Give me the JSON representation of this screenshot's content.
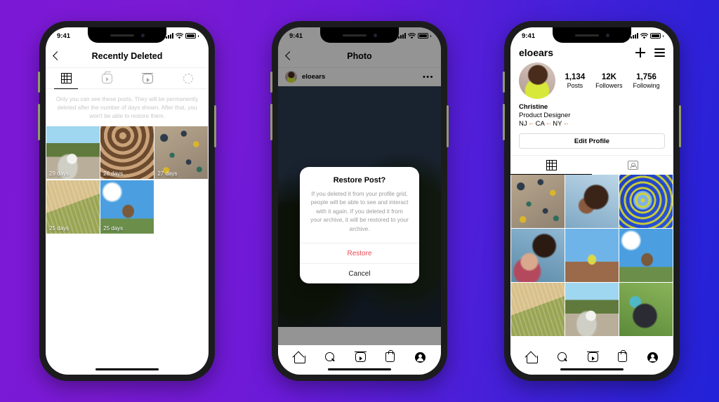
{
  "background": {
    "from": "#7b18d6",
    "to": "#2222d8"
  },
  "phones": [
    {
      "status": {
        "time": "9:41"
      },
      "header": {
        "title": "Recently Deleted",
        "back_icon": "back-chevron-icon"
      },
      "tabs": [
        {
          "name": "grid",
          "icon": "grid-icon",
          "active": true
        },
        {
          "name": "igtv",
          "icon": "igtv-icon",
          "active": false
        },
        {
          "name": "reels",
          "icon": "reels-icon",
          "active": false
        },
        {
          "name": "stories",
          "icon": "story-circle-icon",
          "active": false
        }
      ],
      "notice": "Only you can see these posts. They will be permanently deleted after the number of days shown. After that, you won't be able to restore them.",
      "grid": [
        {
          "alt": "white-dog-on-path",
          "style": "ph-dog",
          "days": "29 days"
        },
        {
          "alt": "spiral-shadow-pattern",
          "style": "ph-spiral",
          "days": "28 days"
        },
        {
          "alt": "climbing-wall-holds",
          "style": "ph-climb",
          "days": "27 days"
        },
        {
          "alt": "wheat-field",
          "style": "ph-wheat",
          "days": "25 days"
        },
        {
          "alt": "boot-against-sky",
          "style": "ph-boot",
          "days": "25 days"
        }
      ]
    },
    {
      "status": {
        "time": "9:41"
      },
      "header": {
        "title": "Photo",
        "back_icon": "back-chevron-icon"
      },
      "post": {
        "username": "eloears",
        "menu_icon": "more-options-icon",
        "photo_alt": "dark-landscape-with-grasses",
        "photo_style": "ph-landscape"
      },
      "alert": {
        "title": "Restore Post?",
        "text": "If you deleted it from your profile grid, people will be able to see and interact with it again. If you deleted it from your archive, it will be restored to your archive.",
        "confirm_label": "Restore",
        "confirm_color": "#ed4956",
        "cancel_label": "Cancel"
      }
    },
    {
      "status": {
        "time": "9:41"
      },
      "profile": {
        "handle": "eloears",
        "add_icon": "plus-icon",
        "menu_icon": "hamburger-menu-icon",
        "avatar_alt": "christine-profile-photo",
        "stats": [
          {
            "number": "1,134",
            "label": "Posts"
          },
          {
            "number": "12K",
            "label": "Followers"
          },
          {
            "number": "1,756",
            "label": "Following"
          }
        ],
        "name": "Christine",
        "role": "Product Designer",
        "locations": [
          "NJ",
          "CA",
          "NY"
        ],
        "location_arrow": "➳",
        "edit_label": "Edit Profile",
        "tabs": [
          {
            "name": "posts-grid",
            "icon": "grid-icon",
            "active": true
          },
          {
            "name": "tagged",
            "icon": "tagged-person-icon",
            "active": false
          }
        ],
        "grid": [
          {
            "alt": "climbing-wall-holds",
            "style": "ph-climb"
          },
          {
            "alt": "woman-profile-earring",
            "style": "ph-girl"
          },
          {
            "alt": "blue-yellow-spiral-art",
            "style": "ph-spiro"
          },
          {
            "alt": "two-friends-smiling",
            "style": "ph-two"
          },
          {
            "alt": "yellow-tree-city-building",
            "style": "ph-bldg"
          },
          {
            "alt": "boot-against-sky",
            "style": "ph-boot"
          },
          {
            "alt": "wheat-field",
            "style": "ph-wheat"
          },
          {
            "alt": "white-dog-on-path",
            "style": "ph-dog"
          },
          {
            "alt": "friends-feet-circle",
            "style": "ph-feet"
          }
        ]
      }
    }
  ],
  "bottom_nav": [
    {
      "name": "home",
      "icon": "home-icon"
    },
    {
      "name": "search",
      "icon": "search-icon"
    },
    {
      "name": "reels",
      "icon": "reels-icon"
    },
    {
      "name": "shop",
      "icon": "shop-bag-icon"
    },
    {
      "name": "profile",
      "icon": "profile-avatar-icon"
    }
  ]
}
